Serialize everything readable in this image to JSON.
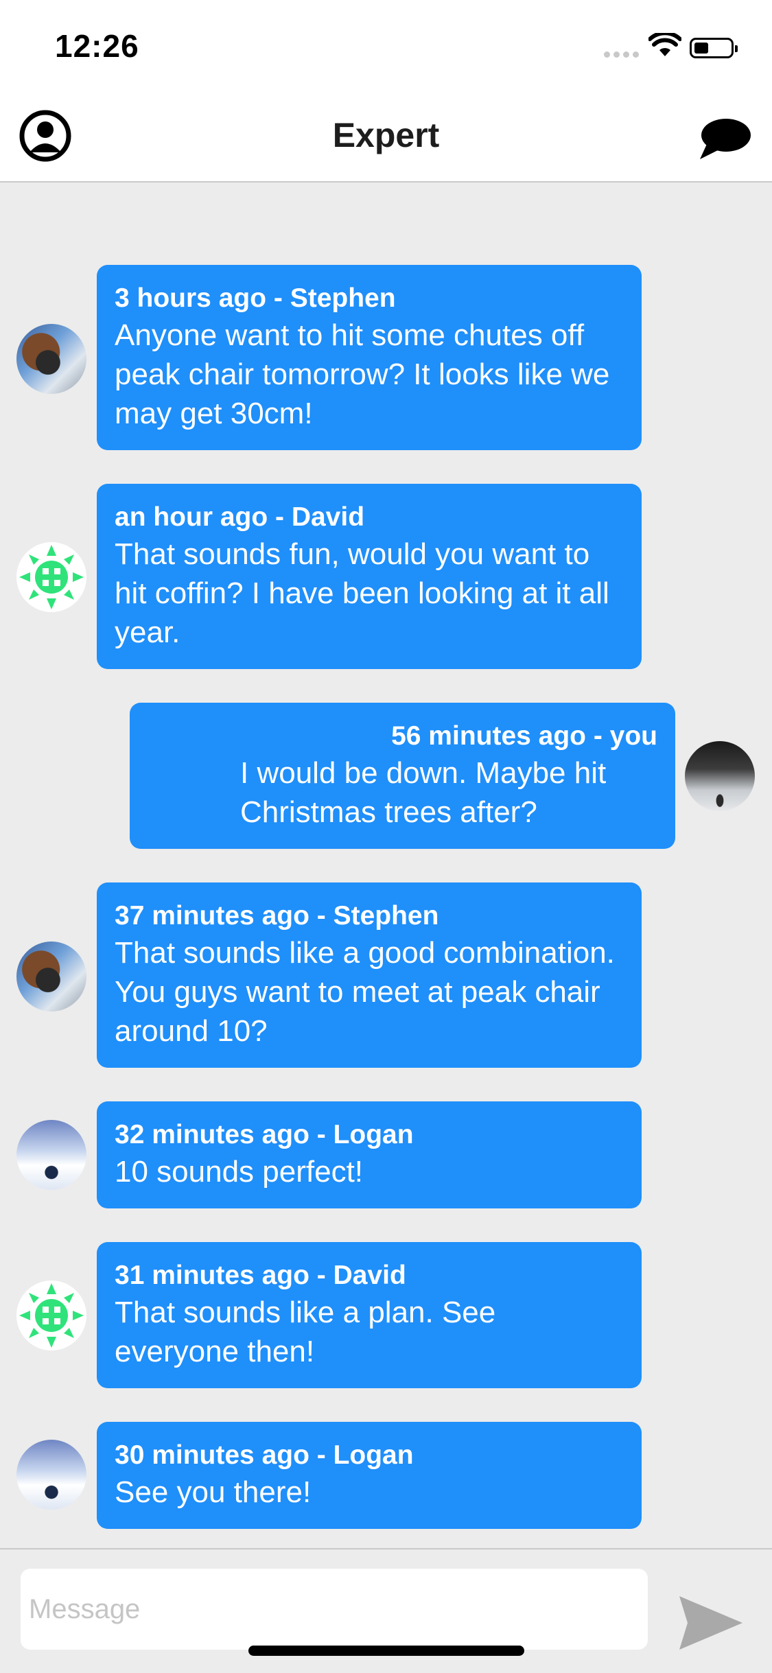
{
  "status_bar": {
    "time": "12:26"
  },
  "nav": {
    "title": "Expert",
    "left_icon": "person-circle-icon",
    "right_icon": "chat-bubble-icon"
  },
  "colors": {
    "bubble": "#1f8ffa",
    "background": "#ececec",
    "bar": "#ffffff"
  },
  "messages": [
    {
      "meta": "3 hours ago - Stephen",
      "text": "Anyone want to hit some chutes off peak chair tomorrow?  It looks like we may get 30cm!",
      "side": "left",
      "avatar": "stephen"
    },
    {
      "meta": "an hour ago - David",
      "text": "That sounds fun, would you want to hit coffin?  I have been looking at it all year.",
      "side": "left",
      "avatar": "david"
    },
    {
      "meta": "56 minutes ago - you",
      "text": "I would be down.  Maybe hit Christmas trees after?",
      "side": "right",
      "avatar": "you"
    },
    {
      "meta": "37 minutes ago - Stephen",
      "text": "That sounds like a good combination.  You guys want to meet at peak chair around 10?",
      "side": "left",
      "avatar": "stephen"
    },
    {
      "meta": "32 minutes ago - Logan",
      "text": "10 sounds perfect!",
      "side": "left",
      "avatar": "logan"
    },
    {
      "meta": "31 minutes ago - David",
      "text": "That sounds like a plan.  See everyone then!",
      "side": "left",
      "avatar": "david"
    },
    {
      "meta": "30 minutes ago - Logan",
      "text": "See you there!",
      "side": "left",
      "avatar": "logan"
    }
  ],
  "input": {
    "placeholder": "Message",
    "value": ""
  },
  "send_icon": "send-arrow-icon"
}
